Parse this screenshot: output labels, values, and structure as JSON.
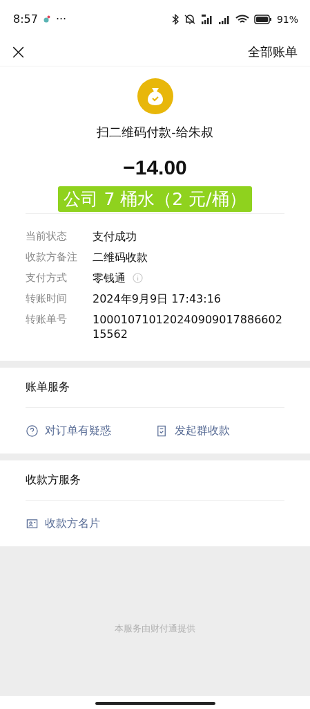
{
  "status_bar": {
    "time": "8:57",
    "more": "···",
    "battery": "91%"
  },
  "nav": {
    "close": "×",
    "right_link": "全部账单"
  },
  "payment": {
    "title": "扫二维码付款-给朱叔",
    "amount": "−14.00",
    "highlight": "公司 7 桶水（2 元/桶）"
  },
  "details": [
    {
      "label": "当前状态",
      "value": "支付成功",
      "kind": "text"
    },
    {
      "label": "收款方备注",
      "value": "二维码收款",
      "kind": "text"
    },
    {
      "label": "支付方式",
      "value": "零钱通",
      "kind": "info"
    },
    {
      "label": "转账时间",
      "value": "2024年9月9日 17:43:16",
      "kind": "text"
    },
    {
      "label": "转账单号",
      "value": "10001071012024090901788660215562",
      "kind": "text"
    }
  ],
  "sections": [
    {
      "title": "账单服务",
      "items": [
        {
          "label": "对订单有疑惑",
          "kind": "question"
        },
        {
          "label": "发起群收款",
          "kind": "receipt"
        }
      ]
    },
    {
      "title": "收款方服务",
      "items": [
        {
          "label": "收款方名片",
          "kind": "card"
        }
      ]
    }
  ],
  "footer": "本服务由财付通提供"
}
